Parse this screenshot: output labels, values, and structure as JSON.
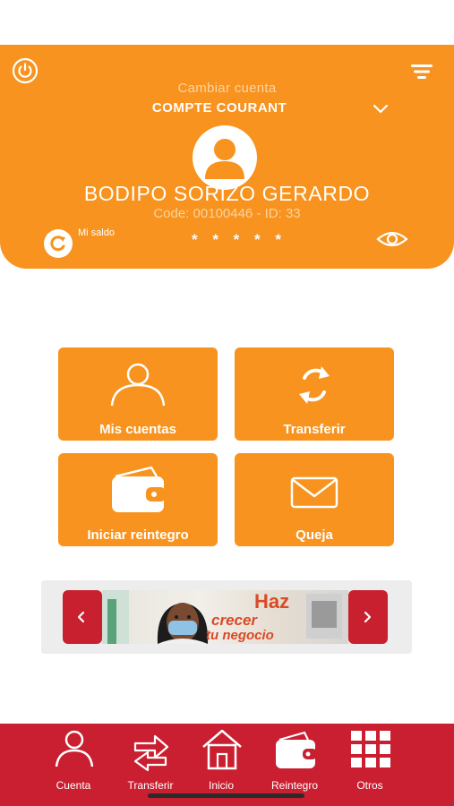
{
  "header": {
    "switch_account_label": "Cambiar cuenta",
    "account_name": "COMPTE COURANT",
    "user_name": "BODIPO SORIZO GERARDO",
    "user_code": "Code: 00100446  - ID: 33",
    "balance_label": "Mi saldo",
    "balance_masked": "* * * * *"
  },
  "tiles": [
    {
      "label": "Mis cuentas",
      "icon": "user-icon"
    },
    {
      "label": "Transferir",
      "icon": "refresh-icon"
    },
    {
      "label": "Iniciar reintegro",
      "icon": "wallet-icon"
    },
    {
      "label": "Queja",
      "icon": "mail-icon"
    }
  ],
  "banner": {
    "line1": "Haz",
    "line2": "crecer",
    "line3": "tu negocio"
  },
  "bottom_nav": [
    {
      "label": "Cuenta",
      "icon": "user-icon"
    },
    {
      "label": "Transferir",
      "icon": "transfer-icon"
    },
    {
      "label": "Inicio",
      "icon": "home-icon"
    },
    {
      "label": "Reintegro",
      "icon": "wallet-icon"
    },
    {
      "label": "Otros",
      "icon": "grid-icon"
    }
  ],
  "colors": {
    "primary_orange": "#f7931e",
    "nav_red": "#c91f30",
    "white": "#ffffff"
  }
}
